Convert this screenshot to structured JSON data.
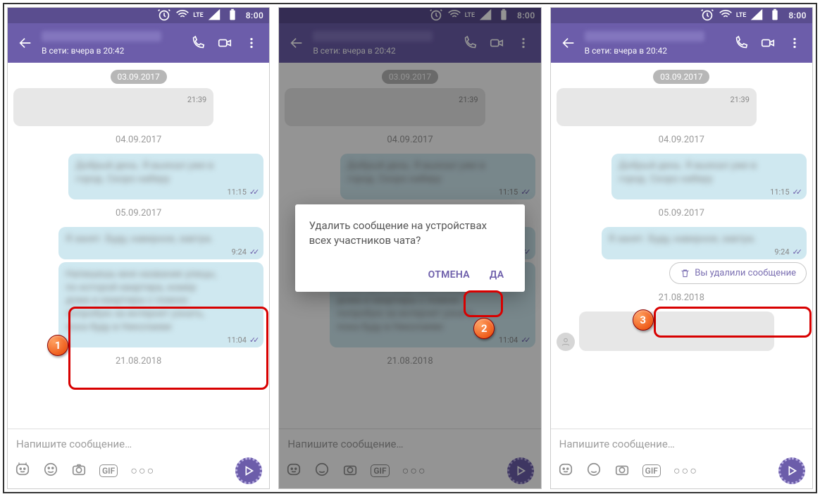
{
  "status": {
    "time": "8:00",
    "lte": "LTE"
  },
  "header": {
    "status": "В сети: вчера в 20:42"
  },
  "dates": {
    "pill1": "03.09.2017",
    "d1": "04.09.2017",
    "d2": "05.09.2017",
    "d3": "21.08.2018"
  },
  "msgs": {
    "m0_time": "21:39",
    "m1_time": "11:15",
    "m2_time": "9:24",
    "m3_time": "11:04",
    "deleted_text": "Вы удалили сообщение"
  },
  "input": {
    "placeholder": "Напишите сообщение…"
  },
  "icons": {
    "gif": "GIF",
    "more": "○○○"
  },
  "dialog": {
    "text": "Удалить сообщение на устройствах всех участников чата?",
    "cancel": "ОТМЕНА",
    "yes": "ДА"
  },
  "markers": {
    "m1": "1",
    "m2": "2",
    "m3": "3"
  },
  "check": "✓✓"
}
